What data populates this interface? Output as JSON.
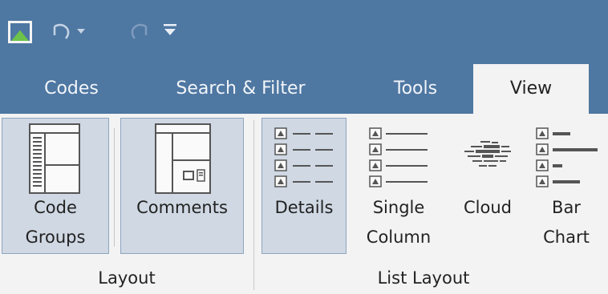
{
  "quick_access": {
    "app_icon": "app-logo-icon",
    "undo_icon": "undo-icon",
    "undo_dropdown_icon": "caret-down-icon",
    "redo_icon": "redo-icon",
    "customize_icon": "customize-quick-access-icon"
  },
  "tabs": [
    {
      "label": "Codes",
      "active": false
    },
    {
      "label": "Search & Filter",
      "active": false
    },
    {
      "label": "Tools",
      "active": false
    },
    {
      "label": "View",
      "active": true
    }
  ],
  "groups": {
    "layout": {
      "label": "Layout",
      "buttons": {
        "code_groups": {
          "line1": "Code",
          "line2": "Groups",
          "icon": "code-groups-layout-icon",
          "selected": true
        },
        "comments": {
          "line1": "Comments",
          "icon": "comments-layout-icon",
          "selected": true
        }
      }
    },
    "list_layout": {
      "label": "List Layout",
      "buttons": {
        "details": {
          "line1": "Details",
          "icon": "details-view-icon",
          "selected": true
        },
        "single_column": {
          "line1": "Single",
          "line2": "Column",
          "icon": "single-column-icon",
          "selected": false
        },
        "cloud": {
          "line1": "Cloud",
          "icon": "word-cloud-icon",
          "selected": false
        },
        "bar_chart": {
          "line1": "Bar",
          "line2": "Chart",
          "icon": "bar-chart-list-icon",
          "selected": false
        }
      }
    }
  },
  "colors": {
    "titlebar": "#4e77a2",
    "ribbon": "#f3f3f3",
    "selected_fill": "#cfd8e3",
    "selected_border": "#8fa6bf"
  }
}
